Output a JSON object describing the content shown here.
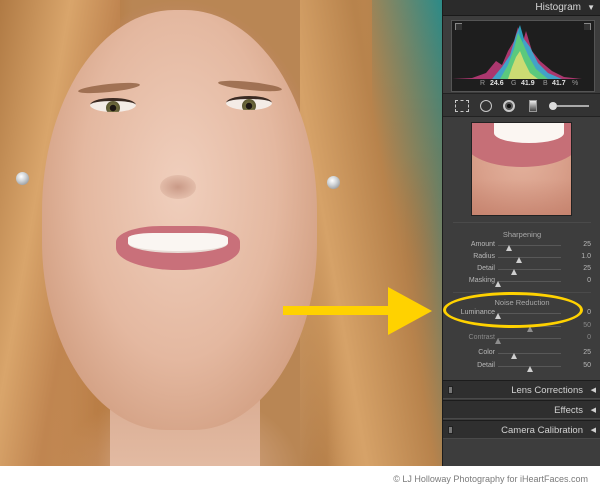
{
  "histogram_panel": {
    "title": "Histogram",
    "collapse_icon": "triangle-down-icon",
    "readout": {
      "r_label": "R",
      "r_value": "24.6",
      "g_label": "G",
      "g_value": "41.9",
      "b_label": "B",
      "b_value": "41.7",
      "unit": "%"
    }
  },
  "toolbar": {
    "tools": [
      "crop-overlay-icon",
      "spot-removal-icon",
      "red-eye-icon",
      "graduated-filter-icon",
      "adjustment-brush-icon"
    ]
  },
  "sharpening": {
    "title": "Sharpening",
    "sliders": [
      {
        "label": "Amount",
        "value": "25",
        "level": 0.17
      },
      {
        "label": "Radius",
        "value": "1.0",
        "level": 0.33
      },
      {
        "label": "Detail",
        "value": "25",
        "level": 0.25
      },
      {
        "label": "Masking",
        "value": "0",
        "level": 0.0
      }
    ]
  },
  "noise_reduction": {
    "title": "Noise Reduction",
    "sliders": [
      {
        "label": "Luminance",
        "value": "0",
        "level": 0.0,
        "dim": false
      },
      {
        "label": "",
        "value": "50",
        "level": 0.5,
        "dim": true
      },
      {
        "label": "Contrast",
        "value": "0",
        "level": 0.0,
        "dim": true
      },
      {
        "label": "Color",
        "value": "25",
        "level": 0.25,
        "dim": false
      },
      {
        "label": "Detail",
        "value": "50",
        "level": 0.5,
        "dim": false
      }
    ]
  },
  "collapsed_panels": [
    {
      "title": "Lens Corrections",
      "has_switch": true
    },
    {
      "title": "Effects",
      "has_switch": false
    },
    {
      "title": "Camera Calibration",
      "has_switch": true
    }
  ],
  "credit": "© LJ Holloway Photography for iHeartFaces.com",
  "colors": {
    "annotation": "#ffd200",
    "panel_bg": "#3d3d3d"
  }
}
